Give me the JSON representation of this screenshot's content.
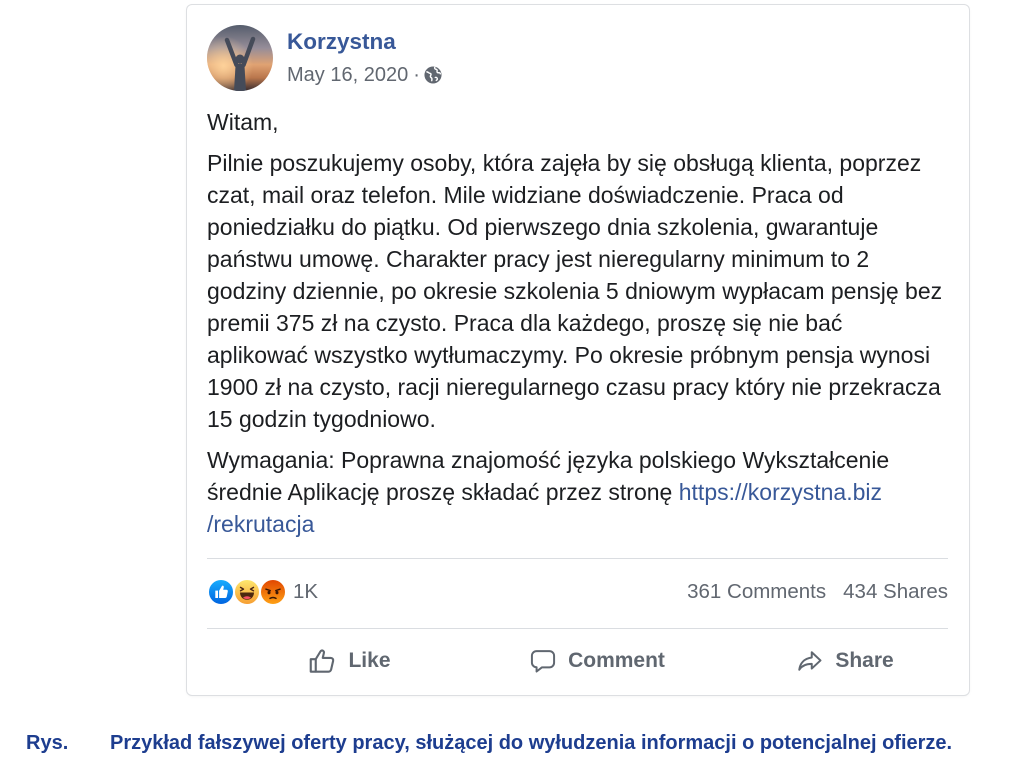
{
  "post": {
    "author": "Korzystna",
    "timestamp": "May 16, 2020",
    "separator": "·",
    "audience_icon": "globe-icon",
    "greeting": "Witam,",
    "offer_lines": [
      "Pilnie poszukujemy osoby, która zajęła by się obsługą klienta, poprzez",
      "czat, mail oraz telefon. Mile widziane doświadczenie. Praca od",
      "poniedziałku do piątku. Od pierwszego dnia szkolenia, gwarantuje",
      "państwu umowę. Charakter pracy jest nieregularny minimum to 2",
      "godziny dziennie, po okresie szkolenia 5 dniowym wypłacam pensję bez",
      "premii 375 zł na czysto. Praca dla każdego, proszę się nie bać",
      "aplikować wszystko wytłumaczymy. Po okresie próbnym pensja wynosi",
      "1900 zł na czysto, racji nieregularnego czasu pracy który nie przekracza",
      "15 godzin tygodniowo."
    ],
    "requirements_lines": [
      "Wymagania: Poprawna znajomość języka polskiego Wykształcenie",
      "średnie Aplikację proszę składać przez stronę"
    ],
    "link_lines": [
      "https://korzystna.biz",
      "/rekrutacja"
    ]
  },
  "stats": {
    "reaction_icons": [
      "like-reaction-icon",
      "haha-reaction-icon",
      "angry-reaction-icon"
    ],
    "reaction_count": "1K",
    "comments": "361 Comments",
    "shares": "434 Shares"
  },
  "actions": [
    {
      "label": "Like",
      "icon": "thumbs-up-icon"
    },
    {
      "label": "Comment",
      "icon": "comment-icon"
    },
    {
      "label": "Share",
      "icon": "share-icon"
    }
  ],
  "caption": {
    "label": "Rys.",
    "text": "Przykład fałszywej oferty pracy, służącej do wyłudzenia informacji o potencjalnej ofierze."
  },
  "colors": {
    "author": "#385898",
    "link": "#385898",
    "body_text": "#1c1e21",
    "meta_text": "#616770",
    "action_text": "#606770",
    "divider": "#dadde1",
    "caption": "#1d3d8f",
    "like_reaction": "#1877f2",
    "haha_reaction": "#f7b125",
    "angry_reaction": "#e9710f"
  }
}
